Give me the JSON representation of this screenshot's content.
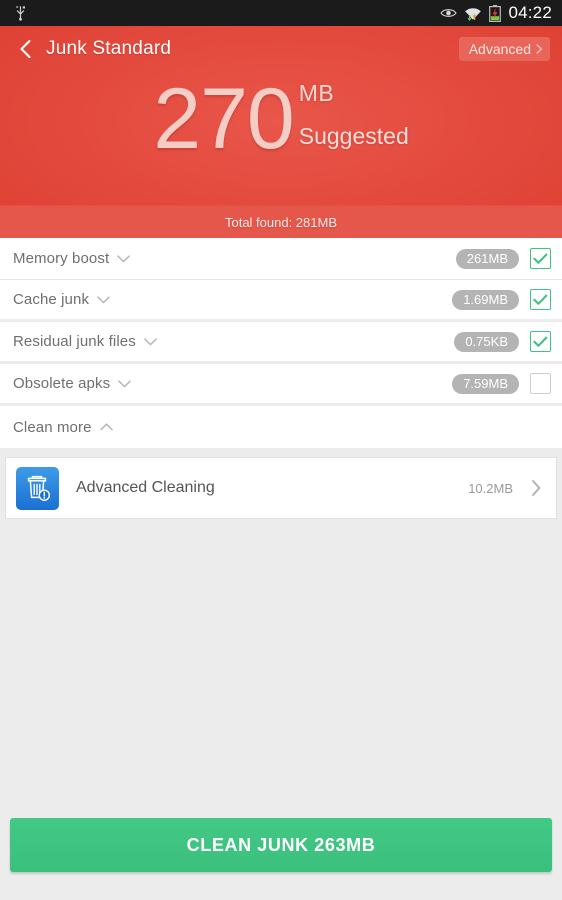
{
  "statusbar": {
    "time": "04:22",
    "icons": [
      "usb-icon",
      "eye-icon",
      "wifi-icon",
      "battery-charging-icon"
    ]
  },
  "header": {
    "back_icon": "back-chevron-icon",
    "title": "Junk Standard",
    "advanced_label": "Advanced",
    "advanced_chevron_icon": "chevron-right-icon",
    "amount": "270",
    "unit": "MB",
    "suggested_label": "Suggested",
    "total_found": "Total found: 281MB",
    "accent_red": "#e2483b",
    "band_red": "#e4574a",
    "amount_color": "#f4cdc7"
  },
  "junk_items": [
    {
      "label": "Memory boost",
      "size": "261MB",
      "checked": true,
      "chevron": "chevron-down-icon"
    },
    {
      "label": "Cache junk",
      "size": "1.69MB",
      "checked": true,
      "chevron": "chevron-down-icon"
    },
    {
      "label": "Residual junk files",
      "size": "0.75KB",
      "checked": true,
      "chevron": "chevron-down-icon"
    },
    {
      "label": "Obsolete apks",
      "size": "7.59MB",
      "checked": false,
      "chevron": "chevron-down-icon"
    }
  ],
  "clean_more": {
    "label": "Clean more",
    "chevron": "chevron-up-icon"
  },
  "advanced_cleaning": {
    "icon": "trash-alert-icon",
    "title": "Advanced Cleaning",
    "size": "10.2MB",
    "chevron": "chevron-right-icon"
  },
  "cta": {
    "label": "CLEAN JUNK 263MB",
    "color": "#3bbf7c"
  },
  "colors": {
    "page_background": "#ececec",
    "pill_grey": "#b4b4b4",
    "check_green": "#3fc380"
  }
}
